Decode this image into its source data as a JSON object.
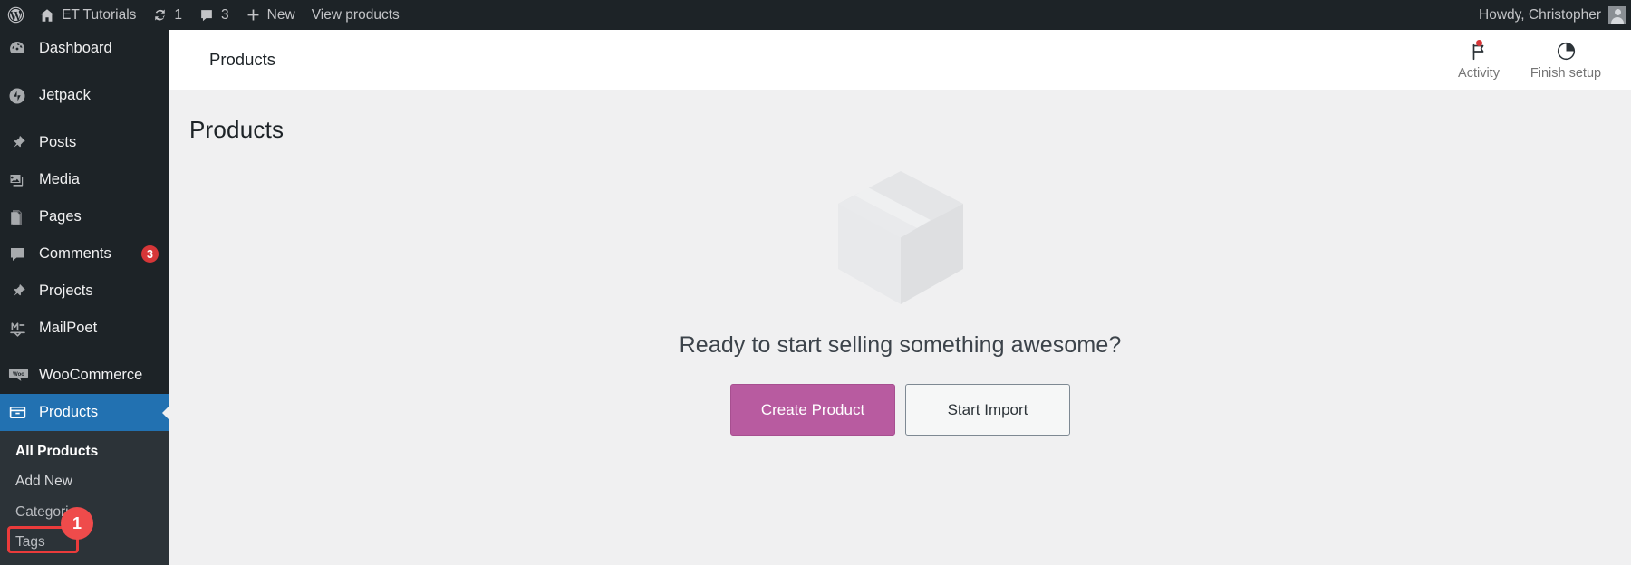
{
  "adminbar": {
    "logo_icon": "wordpress-logo-icon",
    "site_icon": "home-icon",
    "site_name": "ET Tutorials",
    "updates_icon": "updates-icon",
    "updates_count": "1",
    "comments_icon": "comment-bubble-icon",
    "comments_count": "3",
    "new_icon": "plus-icon",
    "new_label": "New",
    "view_products_label": "View products",
    "howdy_label": "Howdy, Christopher",
    "avatar_icon": "user-avatar-icon"
  },
  "sidebar": {
    "items": [
      {
        "icon": "dashboard-icon",
        "label": "Dashboard",
        "current": false,
        "badge": "",
        "sep_after": true
      },
      {
        "icon": "jetpack-icon",
        "label": "Jetpack",
        "current": false,
        "badge": "",
        "sep_after": true
      },
      {
        "icon": "posts-pin-icon",
        "label": "Posts",
        "current": false,
        "badge": "",
        "sep_after": false
      },
      {
        "icon": "media-icon",
        "label": "Media",
        "current": false,
        "badge": "",
        "sep_after": false
      },
      {
        "icon": "pages-icon",
        "label": "Pages",
        "current": false,
        "badge": "",
        "sep_after": false
      },
      {
        "icon": "comments-icon",
        "label": "Comments",
        "current": false,
        "badge": "3",
        "sep_after": false
      },
      {
        "icon": "projects-pin-icon",
        "label": "Projects",
        "current": false,
        "badge": "",
        "sep_after": false
      },
      {
        "icon": "mailpoet-icon",
        "label": "MailPoet",
        "current": false,
        "badge": "",
        "sep_after": true
      },
      {
        "icon": "woocommerce-icon",
        "label": "WooCommerce",
        "current": false,
        "badge": "",
        "sep_after": false
      },
      {
        "icon": "products-box-icon",
        "label": "Products",
        "current": true,
        "badge": "",
        "sep_after": false
      }
    ],
    "submenu": [
      {
        "label": "All Products",
        "current": true,
        "highlighted": false
      },
      {
        "label": "Add New",
        "current": false,
        "highlighted": true
      },
      {
        "label": "Categories",
        "current": false,
        "highlighted": false
      },
      {
        "label": "Tags",
        "current": false,
        "highlighted": false
      }
    ],
    "annotation": {
      "step_number": "1",
      "target_label": "Add New",
      "color": "#ef4b4b"
    }
  },
  "header": {
    "breadcrumb": "Products",
    "actions": [
      {
        "icon": "flag-activity-icon",
        "label": "Activity",
        "has_dot": true
      },
      {
        "icon": "pie-setup-icon",
        "label": "Finish setup",
        "has_dot": false
      }
    ]
  },
  "main": {
    "page_title": "Products",
    "illustration_icon": "package-box-illustration",
    "heading": "Ready to start selling something awesome?",
    "buttons": [
      {
        "label": "Create Product",
        "style": "primary"
      },
      {
        "label": "Start Import",
        "style": "secondary"
      }
    ]
  },
  "colors": {
    "admin_dark": "#1d2327",
    "submenu_dark": "#2c3338",
    "accent_blue": "#2271b1",
    "badge_red": "#d63638",
    "annotation_red": "#ef4b4b",
    "woo_purple": "#b85ba0",
    "content_bg": "#f0f0f1"
  }
}
